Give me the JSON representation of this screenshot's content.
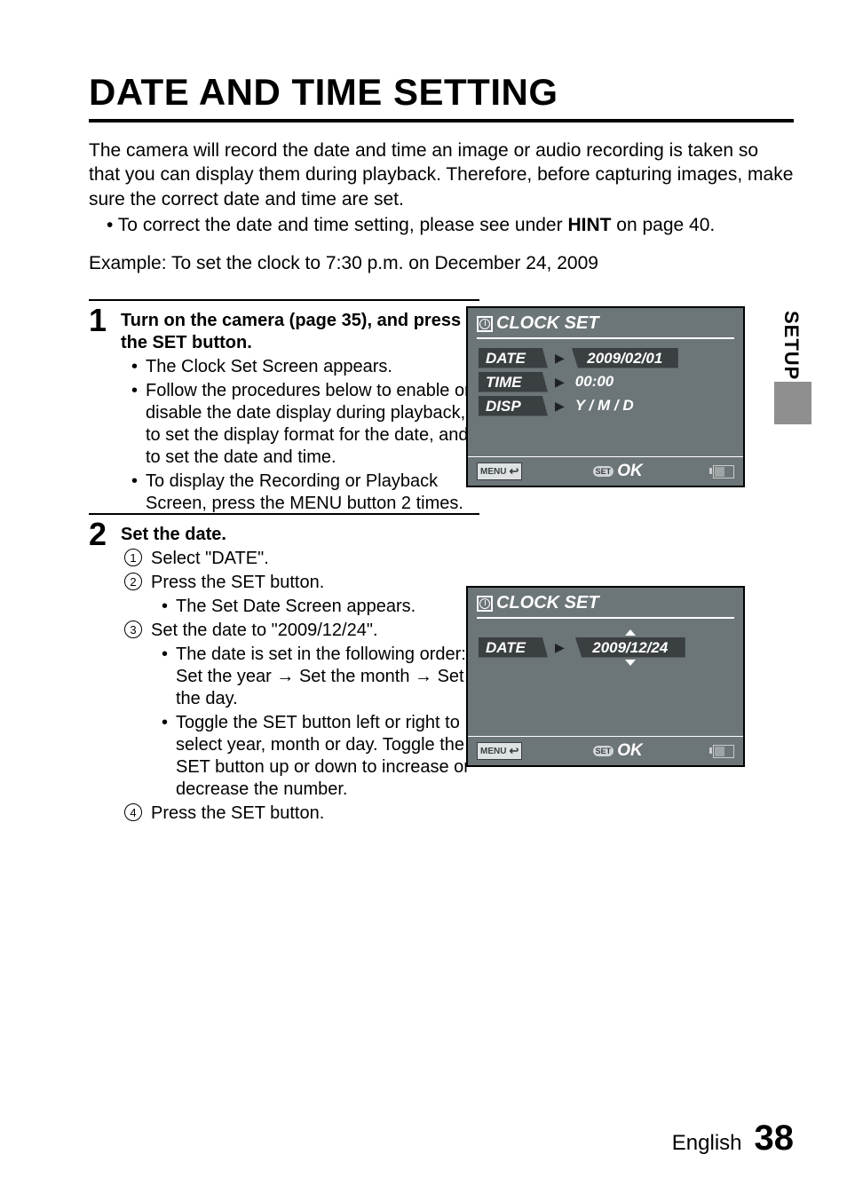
{
  "title": "DATE AND TIME SETTING",
  "intro_text": "The camera will record the date and time an image or audio recording is taken so that you can display them during playback. Therefore, before capturing images, make sure the correct date and time are set.",
  "intro_bullet_prefix": "• To correct the date and time setting, please see under ",
  "intro_bullet_bold": "HINT",
  "intro_bullet_suffix": " on page 40.",
  "example_line": "Example: To set the clock to 7:30 p.m. on December 24, 2009",
  "side_tab": "SETUP",
  "step1": {
    "num": "1",
    "head": "Turn on the camera (page 35), and press the SET button.",
    "b1": "The Clock Set Screen appears.",
    "b2": "Follow the procedures below to enable or disable the date display during playback, to set the display format for the date, and to set the date and time.",
    "b3": "To display the Recording or Playback Screen, press the MENU button 2 times."
  },
  "step2": {
    "num": "2",
    "head": "Set the date.",
    "i1": "Select \"DATE\".",
    "i2": "Press the SET button.",
    "i2_sub": "The Set Date Screen appears.",
    "i3": "Set the date to \"2009/12/24\".",
    "i3_sub1": "The date is set in the following order: Set the year → Set the month → Set the day.",
    "i3_sub2": "Toggle the SET button left or right to select year, month or day. Toggle the SET button up or down to increase or decrease the number.",
    "i4": "Press the SET button."
  },
  "screen_labels": {
    "title": "CLOCK SET",
    "date": "DATE",
    "time": "TIME",
    "disp": "DISP",
    "menu": "MENU",
    "set": "SET",
    "ok": "OK"
  },
  "screen1_values": {
    "date": "2009/02/01",
    "time": "00:00",
    "disp": "Y / M / D"
  },
  "screen2_values": {
    "date": "2009/12/24"
  },
  "footer": {
    "lang": "English",
    "page": "38"
  }
}
